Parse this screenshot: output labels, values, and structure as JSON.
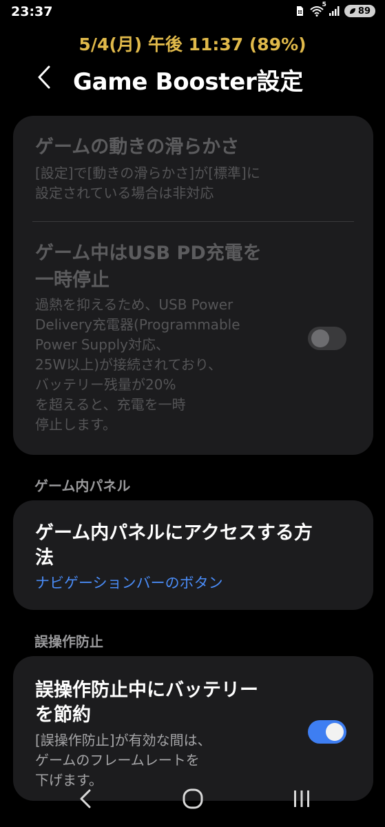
{
  "status_bar": {
    "time": "23:37",
    "icons": [
      "sim-card-icon",
      "wifi-icon",
      "signal-icon"
    ],
    "wifi_badge": "5",
    "battery_level": "89"
  },
  "date_line": "5/4(月) 午後 11:37 (89%)",
  "header": {
    "back_icon": "back-chevron-icon",
    "title": "Game Booster設定"
  },
  "settings": {
    "smoothness": {
      "title": "ゲームの動きの滑らかさ",
      "description_line1": "[設定]で[動きの滑らかさ]が[標準]に",
      "description_line2": "設定されている場合は非対応",
      "enabled": false
    },
    "pause_usb_pd": {
      "title_line1": "ゲーム中はUSB PD充電を",
      "title_line2": "一時停止",
      "description_lines": [
        "過熱を抑えるため、USB Power",
        "Delivery充電器(Programmable",
        "Power Supply対応、",
        "25W以上)が接続されており、",
        "バッテリー残量が20%",
        "を超えると、充電を一時",
        "停止します。"
      ],
      "toggle_on": false
    }
  },
  "in_game_panel": {
    "section_label": "ゲーム内パネル",
    "access_title_line1": "ゲーム内パネルにアクセスする方",
    "access_title_line2": "法",
    "access_value": "ナビゲーションバーのボタン"
  },
  "block_touches": {
    "section_label": "誤操作防止",
    "battery_title_line1": "誤操作防止中にバッテリー",
    "battery_title_line2": "を節約",
    "description_lines": [
      "[誤操作防止]が有効な間は、",
      "ゲームのフレームレートを",
      "下げます。"
    ],
    "toggle_on": true
  },
  "nav_bar": {
    "back_icon": "nav-back-icon",
    "home_icon": "nav-home-icon",
    "recents_icon": "nav-recents-icon"
  },
  "colors": {
    "background": "#000000",
    "card": "#1c1c1e",
    "date_accent": "#e0b94a",
    "link_blue": "#4a8cf7",
    "toggle_on": "#3e7ef2"
  }
}
